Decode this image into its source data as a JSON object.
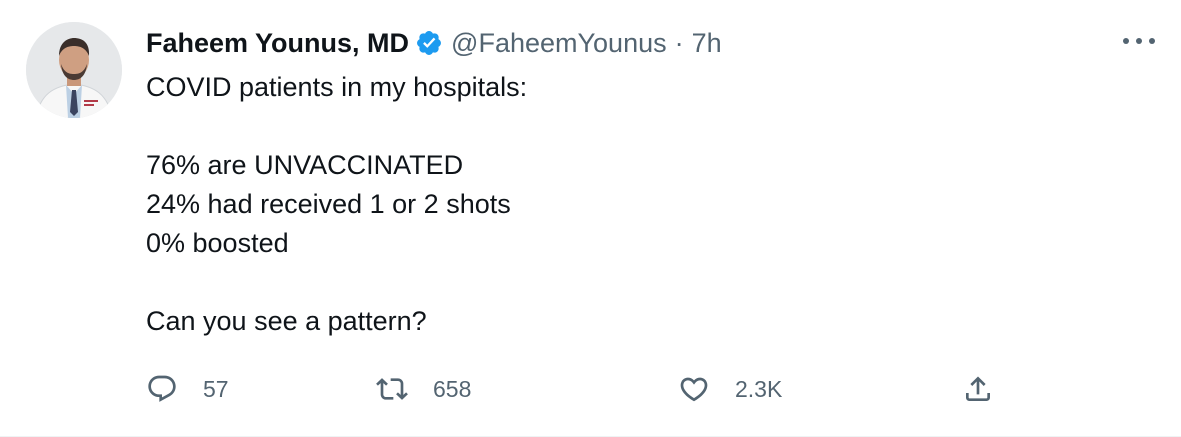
{
  "author": {
    "name": "Faheem Younus, MD",
    "handle": "@FaheemYounus",
    "separator": "·",
    "time": "7h",
    "avatar_icon": "avatar-photo",
    "verified_icon": "verified-badge-icon",
    "verified_color": "#1d9bf0"
  },
  "tweet": {
    "lines": [
      "COVID patients in my hospitals:",
      "",
      "76% are UNVACCINATED",
      "24% had received 1 or 2 shots",
      "0% boosted",
      "",
      "Can you see a pattern?"
    ]
  },
  "actions": {
    "reply": {
      "icon": "reply-icon",
      "count": "57"
    },
    "retweet": {
      "icon": "retweet-icon",
      "count": "658"
    },
    "like": {
      "icon": "heart-icon",
      "count": "2.3K"
    },
    "share": {
      "icon": "share-icon"
    }
  },
  "more_icon": "more-options-icon",
  "colors": {
    "text": "#0f1419",
    "secondary": "#536471"
  }
}
